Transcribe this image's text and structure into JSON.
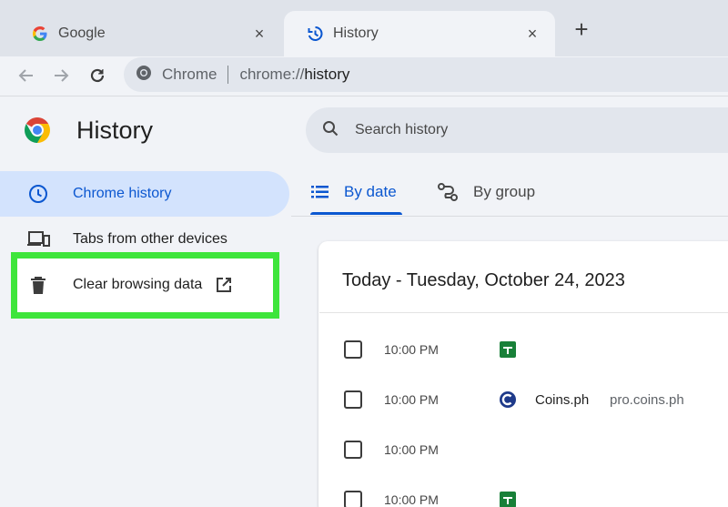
{
  "browser": {
    "tabs": [
      {
        "label": "Google",
        "icon": "google-g-icon"
      },
      {
        "label": "History",
        "icon": "history-icon",
        "active": true
      }
    ],
    "new_tab_symbol": "+",
    "tab_close_symbol": "×",
    "omnibox": {
      "chip": "Chrome",
      "url_prefix": "chrome://",
      "url_path": "history"
    }
  },
  "page": {
    "title": "History",
    "search_placeholder": "Search history"
  },
  "sidebar": {
    "items": [
      {
        "label": "Chrome history",
        "icon": "clock-icon",
        "selected": true
      },
      {
        "label": "Tabs from other devices",
        "icon": "devices-icon"
      },
      {
        "label": "Clear browsing data",
        "icon": "trash-icon",
        "external": "open-in-new-icon"
      }
    ]
  },
  "main": {
    "tabs": [
      {
        "label": "By date",
        "icon": "list-icon",
        "selected": true
      },
      {
        "label": "By group",
        "icon": "group-icon"
      }
    ],
    "card": {
      "header": "Today - Tuesday, October 24, 2023",
      "rows": [
        {
          "time": "10:00 PM",
          "favicon": "google-sheets-icon",
          "title": "",
          "domain": ""
        },
        {
          "time": "10:00 PM",
          "favicon": "coins-ph-icon",
          "title": "Coins.ph",
          "domain": "pro.coins.ph"
        },
        {
          "time": "10:00 PM",
          "favicon": "",
          "title": "",
          "domain": ""
        },
        {
          "time": "10:00 PM",
          "favicon": "google-sheets-icon",
          "title": "",
          "domain": ""
        }
      ]
    }
  },
  "colors": {
    "accent": "#0b57d0",
    "selected_bg": "#d3e3fd",
    "highlight_box": "#3ee53b",
    "page_bg": "#f1f3f7"
  }
}
